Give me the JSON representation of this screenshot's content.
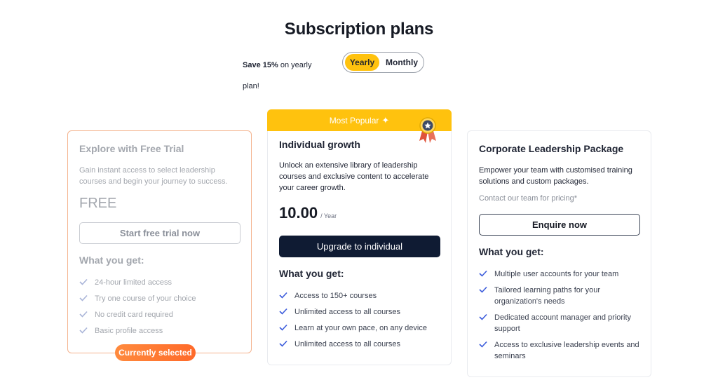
{
  "page": {
    "title": "Subscription plans"
  },
  "billing": {
    "save_bold": "Save 15%",
    "save_rest": " on yearly plan!",
    "options": [
      "Yearly",
      "Monthly"
    ],
    "selected": "Yearly"
  },
  "plans": {
    "free": {
      "title": "Explore with Free Trial",
      "description": "Gain instant access to select leadership courses and begin your journey to success.",
      "price": "FREE",
      "button": "Start free trial now",
      "what_you_get": "What you get:",
      "features": [
        "24-hour limited access",
        "Try one course of your choice",
        "No credit card required",
        "Basic profile access"
      ],
      "status_badge": "Currently selected"
    },
    "individual": {
      "banner": "Most Popular",
      "title": "Individual growth",
      "description": "Unlock an extensive library of leadership courses and exclusive content to accelerate your career growth.",
      "price": "10.00",
      "period": "/ Year",
      "button": "Upgrade to individual",
      "what_you_get": "What you get:",
      "features": [
        "Access to 150+ courses",
        "Unlimited access to all courses",
        "Learn at your own pace, on any device",
        "Unlimited access to all courses"
      ]
    },
    "corporate": {
      "title": "Corporate Leadership Package",
      "description": "Empower your team with customised training solutions and custom packages.",
      "contact": "Contact our team for pricing*",
      "button": "Enquire now",
      "what_you_get": "What you get:",
      "features": [
        "Multiple user accounts for your team",
        "Tailored learning paths for your organization's needs",
        "Dedicated account manager and priority support",
        "Access to exclusive leadership events and seminars"
      ]
    }
  },
  "colors": {
    "accent": "#ffc20e",
    "dark_button": "#0f1b33",
    "check": "#3b5bdb",
    "selected_pill": "#ff7a33"
  }
}
